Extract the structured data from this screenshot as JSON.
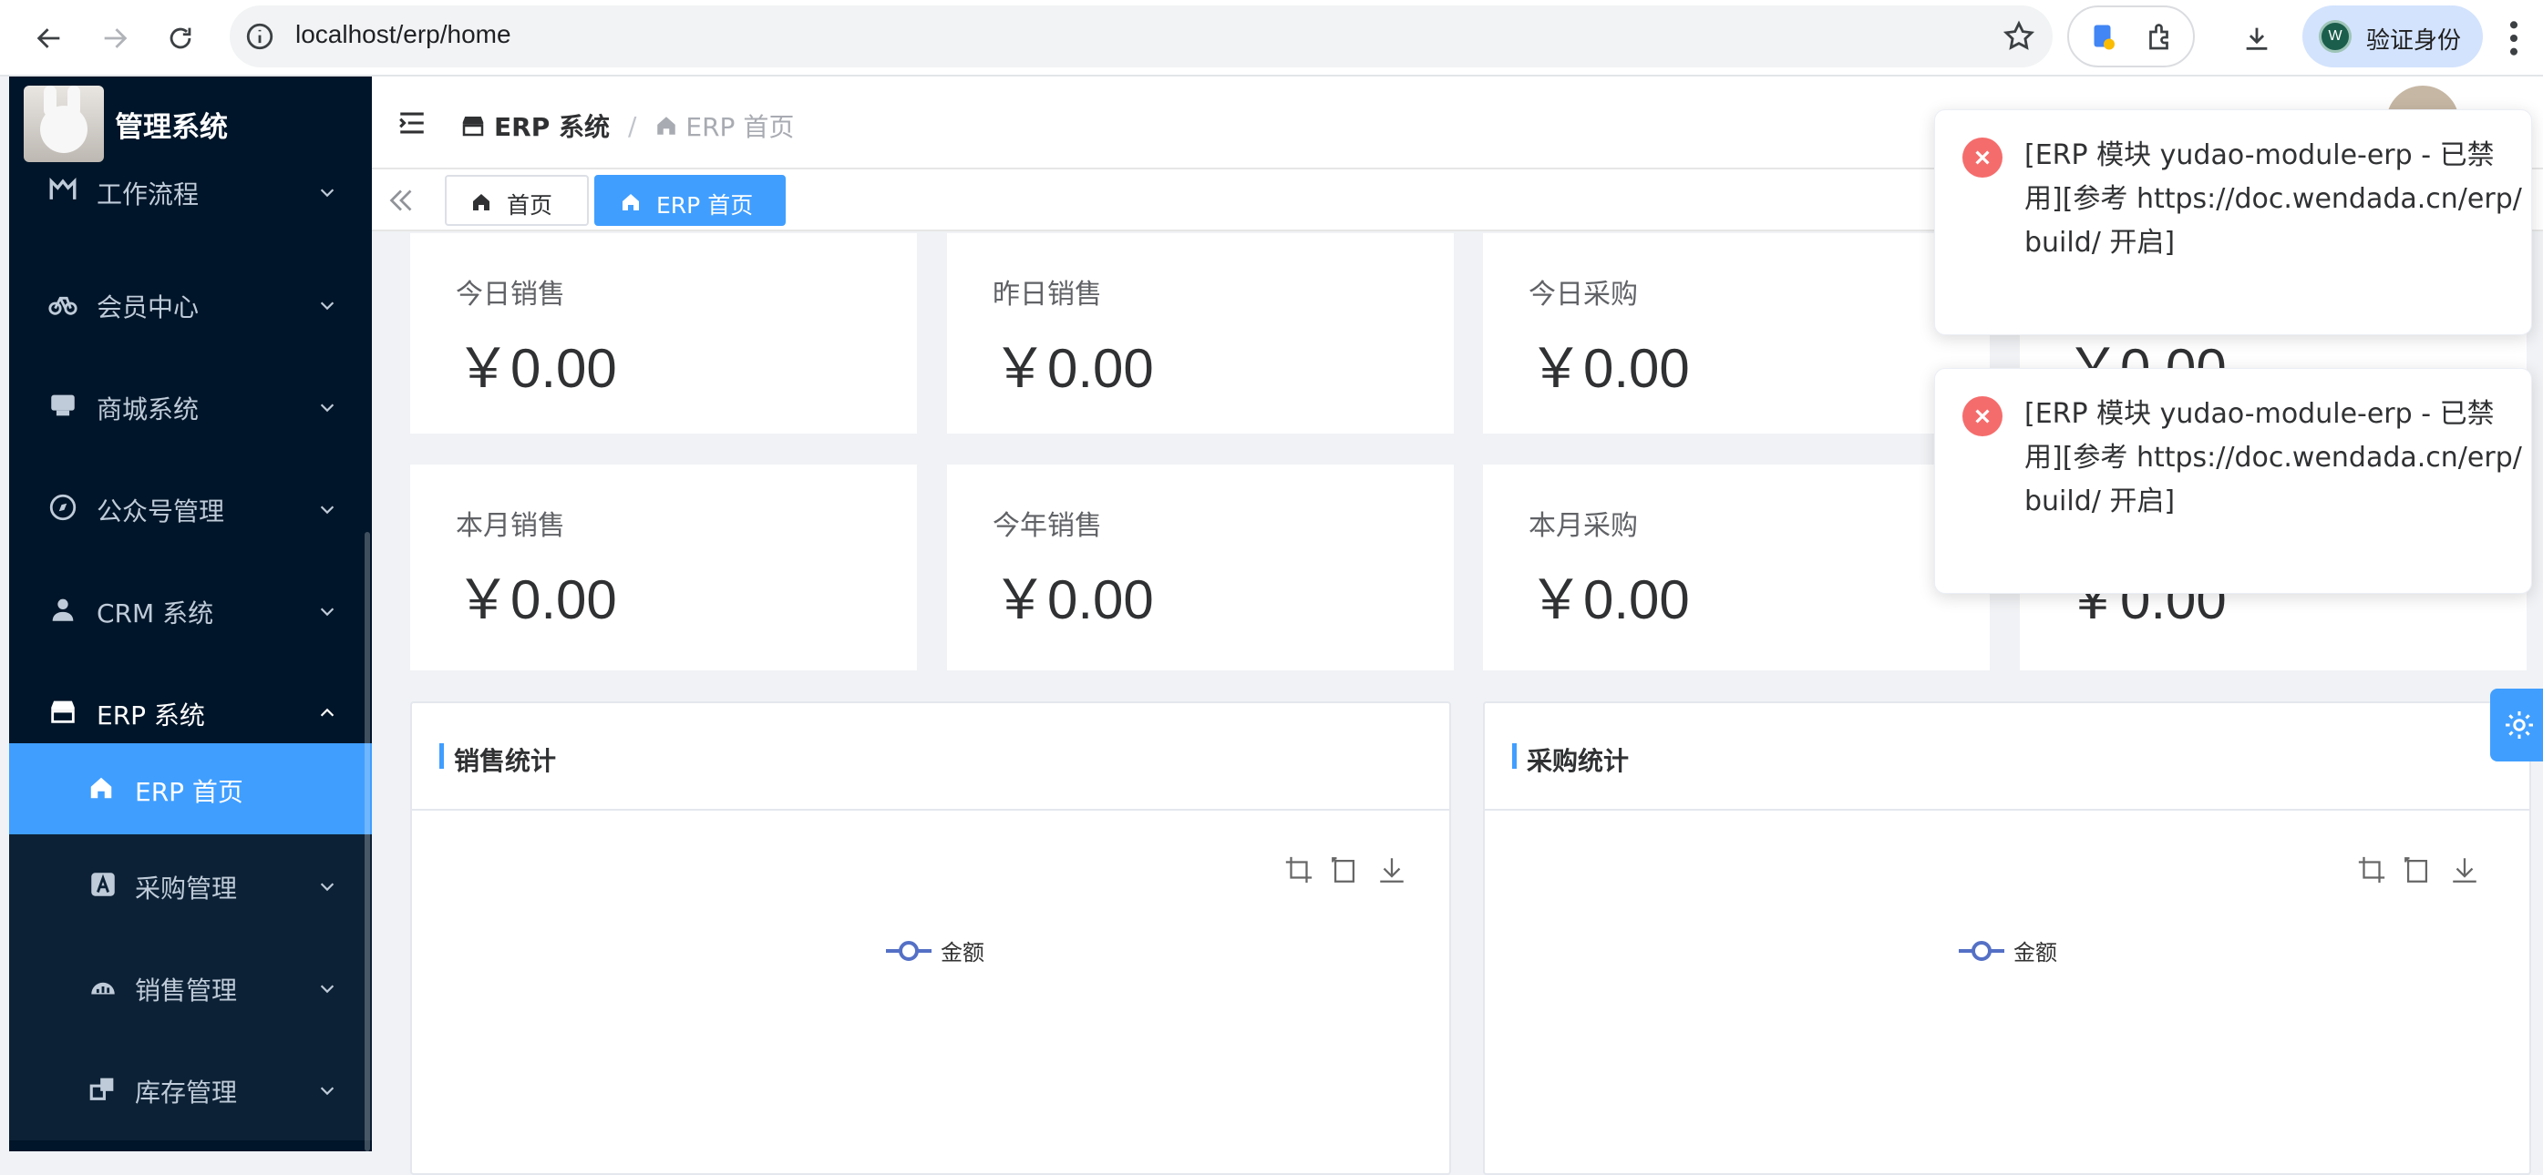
{
  "browser": {
    "url": "localhost/erp/home",
    "profile_label": "验证身份",
    "profile_initial": "W"
  },
  "sidebar": {
    "app_title": "管理系统",
    "items": [
      {
        "label": "工作流程",
        "icon": "workflow-icon"
      },
      {
        "label": "会员中心",
        "icon": "bicycle-icon"
      },
      {
        "label": "商城系统",
        "icon": "shop-icon"
      },
      {
        "label": "公众号管理",
        "icon": "compass-icon"
      },
      {
        "label": "CRM 系统",
        "icon": "user-icon"
      },
      {
        "label": "ERP 系统",
        "icon": "store-icon"
      }
    ],
    "sub_items": [
      {
        "label": "ERP 首页",
        "icon": "home-icon"
      },
      {
        "label": "采购管理",
        "icon": "purchase-icon"
      },
      {
        "label": "销售管理",
        "icon": "sales-icon"
      },
      {
        "label": "库存管理",
        "icon": "inventory-icon"
      }
    ]
  },
  "header": {
    "breadcrumb_root": "ERP 系统",
    "breadcrumb_sep": "/",
    "breadcrumb_current": "ERP 首页"
  },
  "tags": [
    {
      "label": "首页"
    },
    {
      "label": "ERP 首页"
    }
  ],
  "stats": [
    {
      "label": "今日销售",
      "value": "￥0.00"
    },
    {
      "label": "昨日销售",
      "value": "￥0.00"
    },
    {
      "label": "今日采购",
      "value": "￥0.00"
    },
    {
      "label": "",
      "value": "￥0.00"
    },
    {
      "label": "本月销售",
      "value": "￥0.00"
    },
    {
      "label": "今年销售",
      "value": "￥0.00"
    },
    {
      "label": "本月采购",
      "value": "￥0.00"
    },
    {
      "label": "",
      "value": "￥0.00"
    }
  ],
  "panels": [
    {
      "title": "销售统计",
      "legend": "金额"
    },
    {
      "title": "采购统计",
      "legend": "金额"
    }
  ],
  "notifications": [
    {
      "text": "[ERP 模块 yudao-module-erp - 已禁用][参考 https://doc.wendada.cn/erp/build/ 开启]"
    },
    {
      "text": "[ERP 模块 yudao-module-erp - 已禁用][参考 https://doc.wendada.cn/erp/build/ 开启]"
    }
  ],
  "colors": {
    "sidebar_bg": "#001529",
    "accent": "#409eff",
    "error": "#f56c6c"
  }
}
